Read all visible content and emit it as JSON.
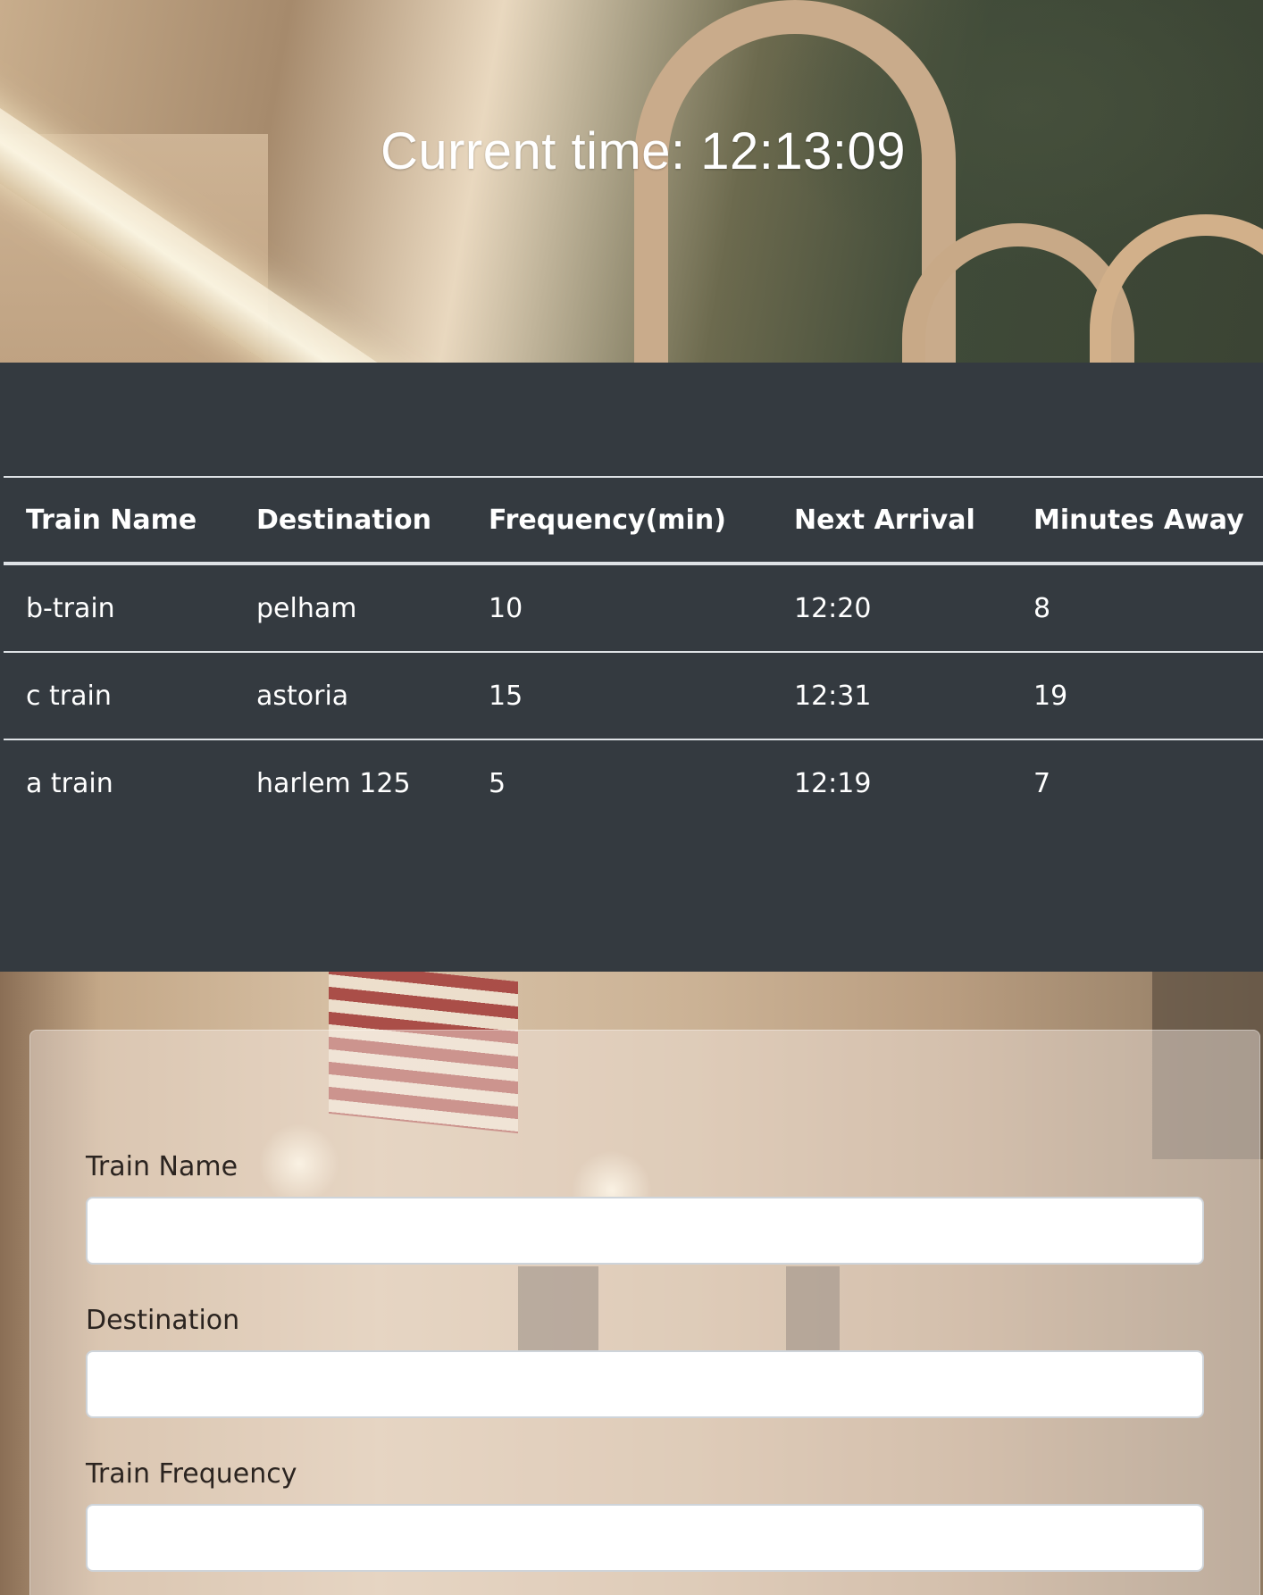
{
  "header": {
    "current_time_label": "Current time: 12:13:09"
  },
  "schedule_table": {
    "columns": [
      "Train Name",
      "Destination",
      "Frequency(min)",
      "Next Arrival",
      "Minutes Away"
    ],
    "rows": [
      [
        "b-train",
        "pelham",
        "10",
        "12:20",
        "8"
      ],
      [
        "c train",
        "astoria",
        "15",
        "12:31",
        "19"
      ],
      [
        "a train",
        "harlem 125",
        "5",
        "12:19",
        "7"
      ]
    ]
  },
  "add_train_form": {
    "fields": [
      {
        "label": "Train Name",
        "value": "",
        "placeholder": ""
      },
      {
        "label": "Destination",
        "value": "",
        "placeholder": ""
      },
      {
        "label": "Train Frequency",
        "value": "",
        "placeholder": ""
      }
    ]
  },
  "colors": {
    "band_background": "#343a40",
    "table_text": "#ffffff",
    "table_border": "#dee2e6"
  }
}
